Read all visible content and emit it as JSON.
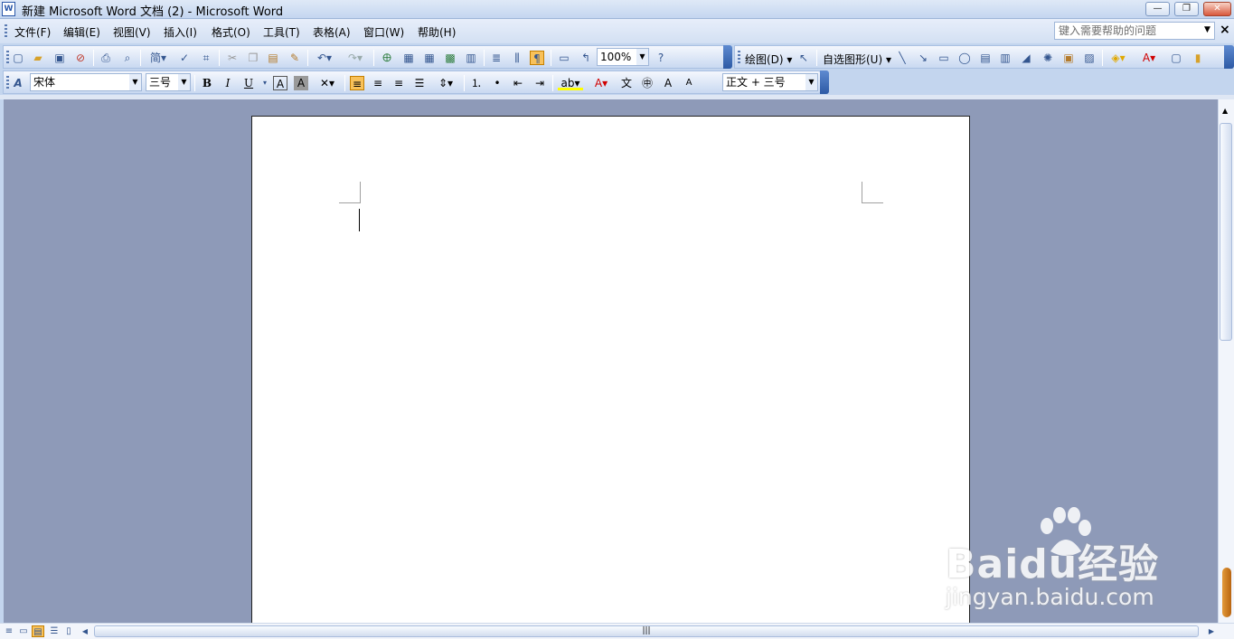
{
  "window": {
    "icon_label": "W",
    "title": "新建 Microsoft Word 文档 (2) - Microsoft Word",
    "minimize": "—",
    "restore": "❐",
    "close": "✕"
  },
  "menu": {
    "items": [
      "文件(F)",
      "编辑(E)",
      "视图(V)",
      "插入(I)",
      "格式(O)",
      "工具(T)",
      "表格(A)",
      "窗口(W)",
      "帮助(H)"
    ],
    "help_placeholder": "键入需要帮助的问题",
    "doc_close": "×"
  },
  "standard_toolbar": {
    "zoom": "100%",
    "icons": [
      "new-icon",
      "open-icon",
      "save-icon",
      "permission-icon",
      "print-icon",
      "print-preview-icon",
      "simplified-chinese-icon",
      "spelling-icon",
      "research-icon",
      "cut-icon",
      "copy-icon",
      "paste-icon",
      "format-painter-icon",
      "undo-icon",
      "redo-icon",
      "hyperlink-icon",
      "tables-borders-icon",
      "insert-table-icon",
      "insert-excel-icon",
      "columns-icon",
      "drawing-icon",
      "document-map-icon",
      "show-hide-icon",
      "read-icon",
      "help-icon"
    ]
  },
  "drawing_toolbar": {
    "draw_label": "绘图(D)",
    "autoshapes_label": "自选图形(U)"
  },
  "formatting_toolbar": {
    "font_name": "宋体",
    "font_size": "三号",
    "style": "正文 + 三号",
    "buttons": {
      "bold": "B",
      "italic": "I",
      "underline": "U"
    }
  },
  "watermark": {
    "brand": "Baidu经验",
    "url": "jingyan.baidu.com"
  },
  "colors": {
    "accent": "#2d5aa5",
    "workspace": "#8e9ab8",
    "font_color": "#d00000",
    "highlight": "#ffff00"
  }
}
